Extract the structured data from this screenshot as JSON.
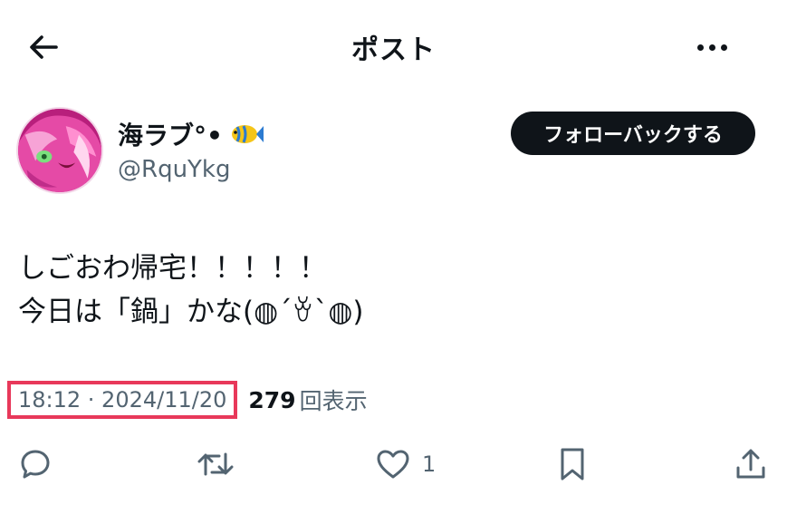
{
  "header": {
    "title": "ポスト"
  },
  "author": {
    "display_name": "海ラブ°•",
    "handle": "@RquYkg",
    "follow_label": "フォローバックする"
  },
  "tweet": {
    "lines": [
      "しごおわ帰宅！！！！！",
      "今日は「鍋」かな(◍´ꈊ`◍)"
    ]
  },
  "meta": {
    "timestamp": "18:12 · 2024/11/20",
    "views_count": "279",
    "views_label": "回表示"
  },
  "actions": {
    "like_count": "1"
  },
  "colors": {
    "text": "#0f1419",
    "secondary": "#536471",
    "highlight": "#e8385a",
    "button": "#0f1419"
  },
  "icons": [
    "back-arrow-icon",
    "more-icon",
    "fish-icon",
    "reply-icon",
    "repost-icon",
    "like-icon",
    "bookmark-icon",
    "share-icon"
  ]
}
